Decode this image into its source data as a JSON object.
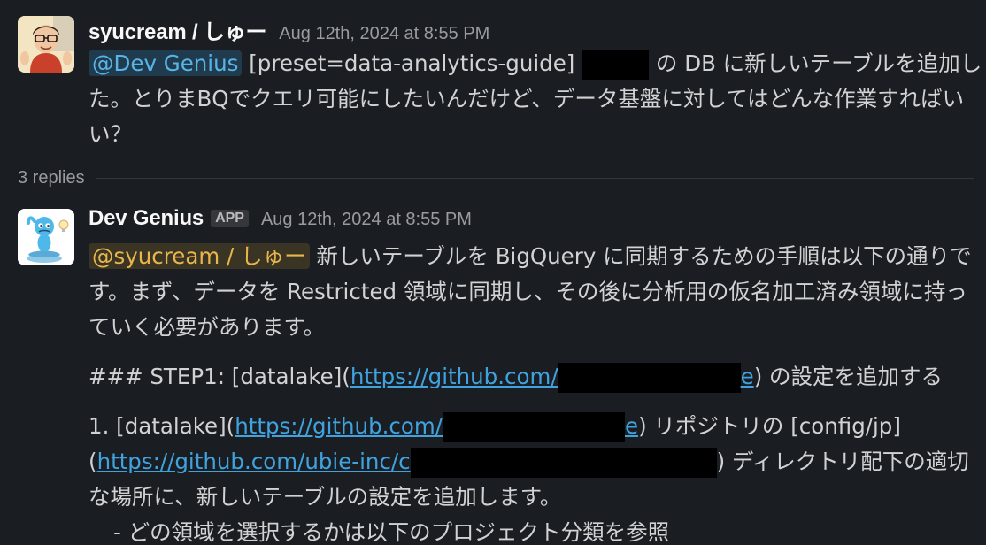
{
  "messages": [
    {
      "author": "syucream / しゅー",
      "timestamp": "Aug 12th, 2024 at 8:55 PM",
      "mention": "@Dev Genius",
      "text_a": " [preset=data-analytics-guide] ",
      "text_b": " の DB に新しいテーブルを追加した。とりまBQでクエリ可能にしたいんだけど、データ基盤に対してはどんな作業すればいい？"
    },
    {
      "author": "Dev Genius",
      "badge": "APP",
      "timestamp": "Aug 12th, 2024 at 8:55 PM",
      "mention": "@syucream / しゅー",
      "intro": " 新しいテーブルを BigQuery に同期するための手順は以下の通りです。まず、データを Restricted 領域に同期し、その後に分析用の仮名加工済み領域に持っていく必要があります。",
      "step_prefix": "### STEP1: [datalake](",
      "step_link": "https://github.com/",
      "step_link_tail": "e",
      "step_suffix": ") の設定を追加する",
      "item_prefix": "1. [datalake](",
      "item_link": "https://github.com/",
      "item_link_tail": "e",
      "item_mid": ") リポジトリの [config/jp]",
      "item_open": "(",
      "item_link2": "https://github.com/ubie-inc/c",
      "item_suffix": ") ディレクトリ配下の適切な場所に、新しいテーブルの設定を追加します。",
      "bullet": "- どの領域を選択するかは以下のプロジェクト分類を参照"
    }
  ],
  "thread": {
    "replies_label": "3 replies"
  },
  "colors": {
    "background": "#1a1d21",
    "mention_bg": "#1f3b4d",
    "mention_fg": "#58b4e6",
    "self_mention_bg": "#3a3424",
    "self_mention_fg": "#e8b64c",
    "link": "#3fa3e0"
  }
}
